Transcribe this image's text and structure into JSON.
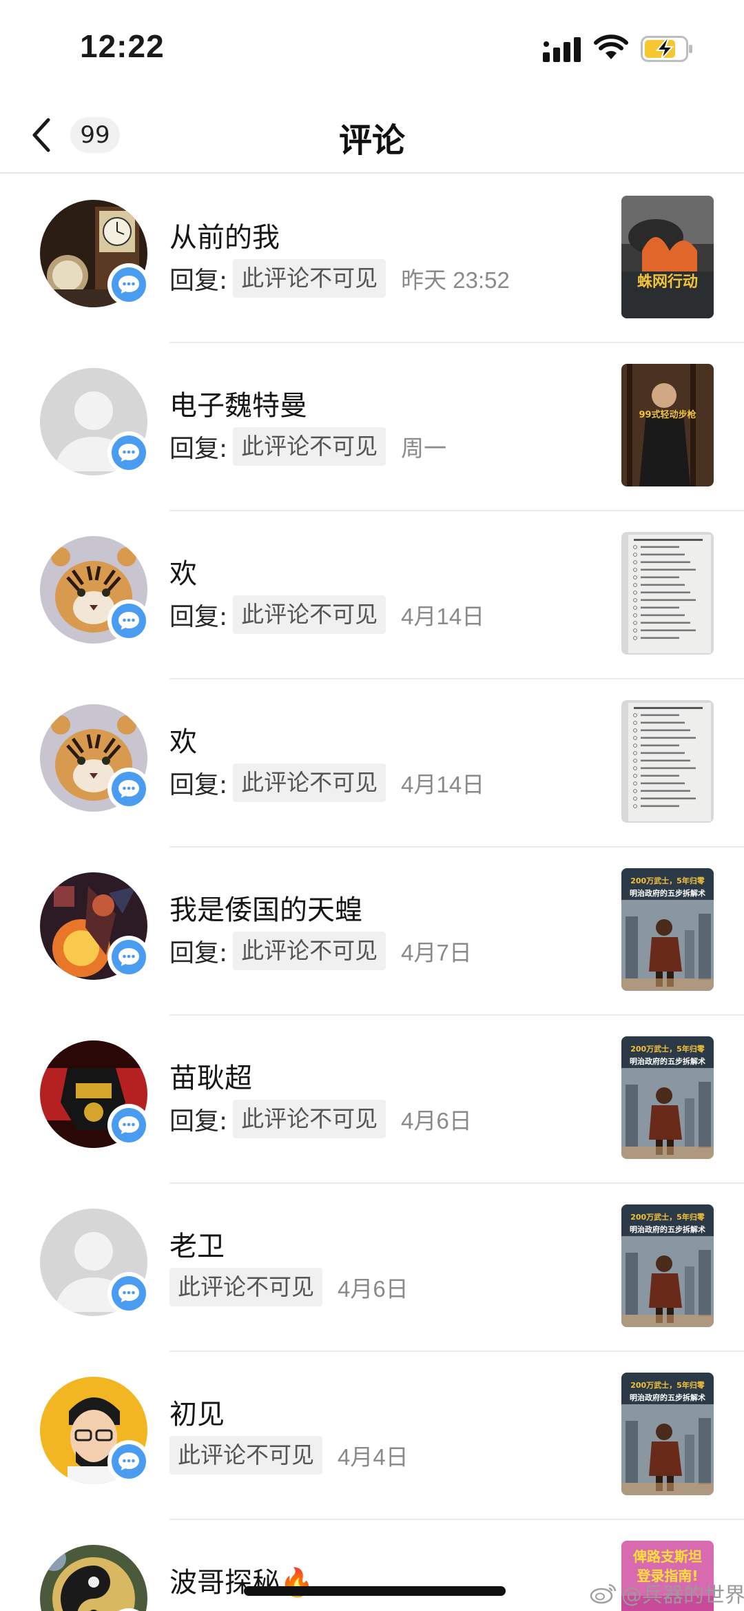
{
  "status_bar": {
    "time": "12:22"
  },
  "nav": {
    "back_count": "99",
    "title": "评论"
  },
  "reply_prefix": "回复:",
  "items": [
    {
      "name": "从前的我",
      "has_reply_prefix": true,
      "hidden_text": "此评论不可见",
      "time": "昨天 23:52",
      "avatar": "clock-photo",
      "thumbnail": "movie-poster",
      "thumb_text": "蛛网行动"
    },
    {
      "name": "电子魏特曼",
      "has_reply_prefix": true,
      "hidden_text": "此评论不可见",
      "time": "周一",
      "avatar": "default",
      "thumbnail": "rifle-video",
      "thumb_text": "99式轻动步枪"
    },
    {
      "name": "欢",
      "has_reply_prefix": true,
      "hidden_text": "此评论不可见",
      "time": "4月14日",
      "avatar": "tiger",
      "thumbnail": "document"
    },
    {
      "name": "欢",
      "has_reply_prefix": true,
      "hidden_text": "此评论不可见",
      "time": "4月14日",
      "avatar": "tiger",
      "thumbnail": "document"
    },
    {
      "name": "我是倭国的天蝗",
      "has_reply_prefix": true,
      "hidden_text": "此评论不可见",
      "time": "4月7日",
      "avatar": "warrior-art",
      "thumbnail": "samurai",
      "thumb_text": "200万武士，5年归零",
      "thumb_subtext": "明治政府的五步拆解术"
    },
    {
      "name": "苗耿超",
      "has_reply_prefix": true,
      "hidden_text": "此评论不可见",
      "time": "4月6日",
      "avatar": "mecha",
      "thumbnail": "samurai",
      "thumb_text": "200万武士，5年归零",
      "thumb_subtext": "明治政府的五步拆解术"
    },
    {
      "name": "老卫",
      "has_reply_prefix": false,
      "hidden_text": "此评论不可见",
      "time": "4月6日",
      "avatar": "default",
      "thumbnail": "samurai",
      "thumb_text": "200万武士，5年归零",
      "thumb_subtext": "明治政府的五步拆解术"
    },
    {
      "name": "初见",
      "has_reply_prefix": false,
      "hidden_text": "此评论不可见",
      "time": "4月4日",
      "avatar": "cartoon-man",
      "thumbnail": "samurai",
      "thumb_text": "200万武士，5年归零",
      "thumb_subtext": "明治政府的五步拆解术"
    },
    {
      "name": "波哥探秘🔥",
      "has_reply_prefix": false,
      "hidden_text": "",
      "time": "",
      "avatar": "yin-yang",
      "thumbnail": "guide-poster",
      "thumb_text": "俾路支斯坦",
      "thumb_subtext": "登录指南!"
    }
  ],
  "watermark": "@兵器的世界",
  "colors": {
    "accent_blue": "#4a9cf0",
    "chip_bg": "#f0f0f0",
    "time_gray": "#8a8a8a",
    "battery_yellow": "#f6c731"
  }
}
